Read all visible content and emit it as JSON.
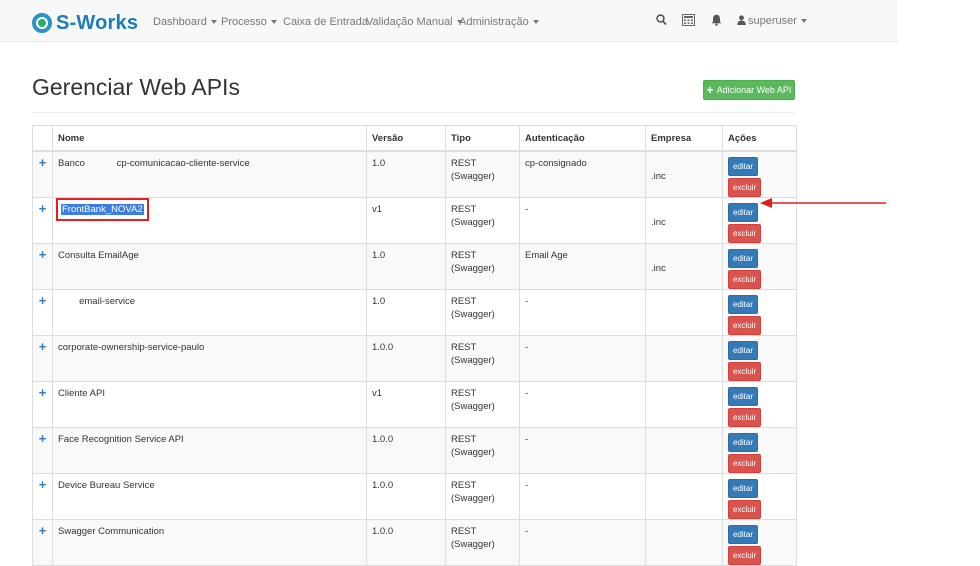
{
  "brand": {
    "name": "S-Works"
  },
  "nav": {
    "items": [
      {
        "label": "Dashboard",
        "dropdown": true
      },
      {
        "label": "Processo",
        "dropdown": true
      },
      {
        "label": "Caixa de Entrada",
        "dropdown": false
      },
      {
        "label": "Validação Manual",
        "dropdown": true
      },
      {
        "label": "Administração",
        "dropdown": true
      }
    ],
    "icons": [
      "search-icon",
      "calculator-icon",
      "bell-icon"
    ],
    "user": "superuser"
  },
  "page": {
    "title": "Gerenciar Web APIs",
    "add_button": "Adicionar Web API"
  },
  "table": {
    "columns": [
      "Nome",
      "Versão",
      "Tipo",
      "Autenticação",
      "Empresa",
      "Ações"
    ],
    "rows": [
      {
        "nome": "Banco            cp-comunicacao-cliente-service",
        "versao": "1.0",
        "tipo": "REST (Swagger)",
        "auth": "cp-consignado",
        "empresa": ".inc"
      },
      {
        "nome": "FrontBank_NOVA2",
        "versao": "v1",
        "tipo": "REST (Swagger)",
        "auth": "-",
        "empresa": ".inc"
      },
      {
        "nome": "Consulta EmailAge",
        "versao": "1.0",
        "tipo": "REST (Swagger)",
        "auth": "Email Age",
        "empresa": ".inc"
      },
      {
        "nome": "        email-service",
        "versao": "1.0",
        "tipo": "REST (Swagger)",
        "auth": "-",
        "empresa": ""
      },
      {
        "nome": "corporate-ownership-service-paulo",
        "versao": "1.0.0",
        "tipo": "REST (Swagger)",
        "auth": "-",
        "empresa": ""
      },
      {
        "nome": "Cliente API",
        "versao": "v1",
        "tipo": "REST (Swagger)",
        "auth": "-",
        "empresa": ""
      },
      {
        "nome": "Face Recognition Service API",
        "versao": "1.0.0",
        "tipo": "REST (Swagger)",
        "auth": "-",
        "empresa": ""
      },
      {
        "nome": "Device Bureau Service",
        "versao": "1.0.0",
        "tipo": "REST (Swagger)",
        "auth": "-",
        "empresa": ""
      },
      {
        "nome": "Swagger Communication",
        "versao": "1.0.0",
        "tipo": "REST (Swagger)",
        "auth": "-",
        "empresa": ""
      }
    ],
    "actions": {
      "edit": "editar",
      "delete": "excluir"
    },
    "expand_symbol": "+"
  },
  "colors": {
    "brand": "#1f7ab8",
    "add_button": "#5cb85c",
    "edit_button": "#337ab7",
    "delete_button": "#d9534f",
    "highlight": "#e02020"
  }
}
